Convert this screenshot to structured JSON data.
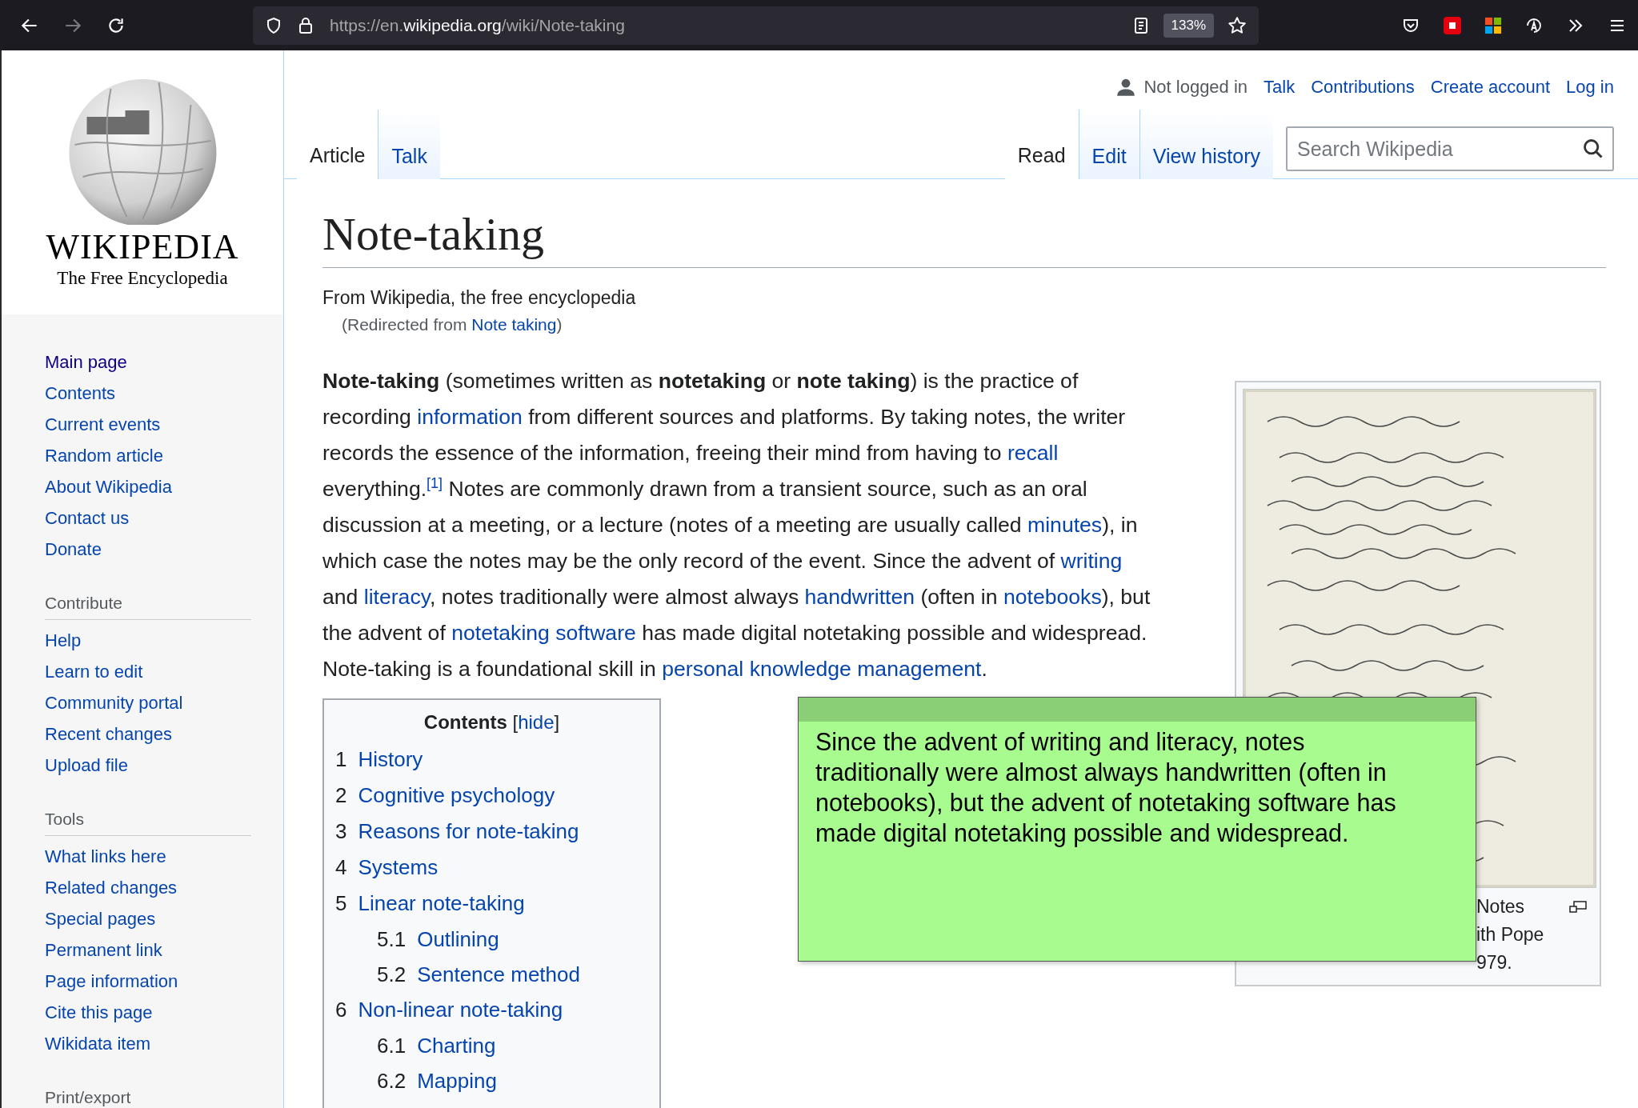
{
  "browser": {
    "url_prefix": "https://en.",
    "url_domain": "wikipedia.org",
    "url_path": "/wiki/Note-taking",
    "zoom": "133%",
    "forward_disabled": true
  },
  "logo": {
    "wordmark": "WIKIPEDIA",
    "tagline": "The Free Encyclopedia"
  },
  "sidebar": {
    "sections": [
      {
        "items": [
          {
            "label": "Main page",
            "visited": true
          },
          {
            "label": "Contents",
            "visited": false
          },
          {
            "label": "Current events",
            "visited": false
          },
          {
            "label": "Random article",
            "visited": false
          },
          {
            "label": "About Wikipedia",
            "visited": false
          },
          {
            "label": "Contact us",
            "visited": false
          },
          {
            "label": "Donate",
            "visited": false
          }
        ]
      },
      {
        "heading": "Contribute",
        "items": [
          {
            "label": "Help",
            "visited": false
          },
          {
            "label": "Learn to edit",
            "visited": false
          },
          {
            "label": "Community portal",
            "visited": false
          },
          {
            "label": "Recent changes",
            "visited": false
          },
          {
            "label": "Upload file",
            "visited": false
          }
        ]
      },
      {
        "heading": "Tools",
        "items": [
          {
            "label": "What links here",
            "visited": false
          },
          {
            "label": "Related changes",
            "visited": false
          },
          {
            "label": "Special pages",
            "visited": false
          },
          {
            "label": "Permanent link",
            "visited": false
          },
          {
            "label": "Page information",
            "visited": false
          },
          {
            "label": "Cite this page",
            "visited": false
          },
          {
            "label": "Wikidata item",
            "visited": false
          }
        ]
      },
      {
        "heading": "Print/export"
      }
    ]
  },
  "personal": {
    "status": "Not logged in",
    "links": [
      "Talk",
      "Contributions",
      "Create account",
      "Log in"
    ]
  },
  "tabs_left": [
    {
      "label": "Article",
      "selected": true
    },
    {
      "label": "Talk",
      "selected": false
    }
  ],
  "tabs_right": [
    {
      "label": "Read",
      "selected": true
    },
    {
      "label": "Edit",
      "selected": false
    },
    {
      "label": "View history",
      "selected": false
    }
  ],
  "search": {
    "placeholder": "Search Wikipedia"
  },
  "article": {
    "title": "Note-taking",
    "tagline": "From Wikipedia, the free encyclopedia",
    "redirect_prefix": "(Redirected from ",
    "redirect_link": "Note taking",
    "redirect_suffix": ")",
    "paragraph": [
      {
        "kind": "bold",
        "text": "Note-taking"
      },
      {
        "kind": "plain",
        "text": " (sometimes written as "
      },
      {
        "kind": "bold",
        "text": "notetaking"
      },
      {
        "kind": "plain",
        "text": " or "
      },
      {
        "kind": "bold",
        "text": "note taking"
      },
      {
        "kind": "plain",
        "text": ") is the practice of recording "
      },
      {
        "kind": "link",
        "text": "information"
      },
      {
        "kind": "plain",
        "text": " from different sources and platforms. By taking notes, the writer records the essence of the information, freeing their mind from having to "
      },
      {
        "kind": "link",
        "text": "recall"
      },
      {
        "kind": "plain",
        "text": " everything."
      },
      {
        "kind": "ref",
        "text": "[1]"
      },
      {
        "kind": "plain",
        "text": " Notes are commonly drawn from a transient source, such as an oral discussion at a meeting, or a lecture (notes of a meeting are usually called "
      },
      {
        "kind": "link",
        "text": "minutes"
      },
      {
        "kind": "plain",
        "text": "), in which case the notes may be the only record of the event. Since the advent of "
      },
      {
        "kind": "link",
        "text": "writing"
      },
      {
        "kind": "plain",
        "text": " and "
      },
      {
        "kind": "link",
        "text": "literacy"
      },
      {
        "kind": "plain",
        "text": ", notes traditionally were almost always "
      },
      {
        "kind": "link",
        "text": "handwritten"
      },
      {
        "kind": "plain",
        "text": " (often in "
      },
      {
        "kind": "link",
        "text": "notebooks"
      },
      {
        "kind": "plain",
        "text": "), but the advent of "
      },
      {
        "kind": "link",
        "text": "notetaking software"
      },
      {
        "kind": "plain",
        "text": " has made digital notetaking possible and widespread. Note-taking is a foundational skill in "
      },
      {
        "kind": "link",
        "text": "personal knowledge management"
      },
      {
        "kind": "plain",
        "text": "."
      }
    ],
    "figure": {
      "kind": "picture",
      "caption_lines": [
        "Notes",
        "ith Pope",
        "979."
      ]
    },
    "contents": {
      "title": "Contents",
      "toggle_open": "[",
      "toggle": "hide",
      "toggle_close": "]",
      "items": [
        {
          "number": "1",
          "label": "History"
        },
        {
          "number": "2",
          "label": "Cognitive psychology"
        },
        {
          "number": "3",
          "label": "Reasons for note-taking"
        },
        {
          "number": "4",
          "label": "Systems"
        },
        {
          "number": "5",
          "label": "Linear note-taking",
          "children": [
            {
              "number": "5.1",
              "label": "Outlining"
            },
            {
              "number": "5.2",
              "label": "Sentence method"
            }
          ]
        },
        {
          "number": "6",
          "label": "Non-linear note-taking",
          "children": [
            {
              "number": "6.1",
              "label": "Charting"
            },
            {
              "number": "6.2",
              "label": "Mapping"
            }
          ]
        }
      ]
    }
  },
  "sticky_note": {
    "text": "Since the advent of writing and literacy, notes traditionally were almost always handwritten (often in notebooks), but the advent of notetaking software has made digital notetaking possible and widespread.",
    "color": "#a8fc8f"
  }
}
